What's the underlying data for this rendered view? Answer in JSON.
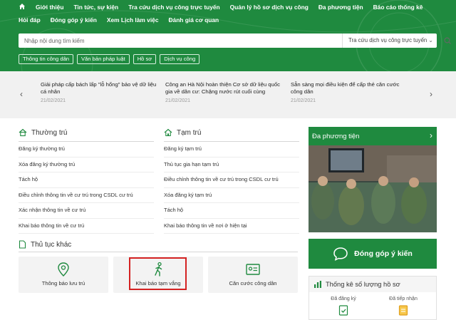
{
  "header": {
    "nav": [
      {
        "id": "home",
        "label": ""
      },
      {
        "id": "gioi-thieu",
        "label": "Giới thiệu"
      },
      {
        "id": "tin-tuc",
        "label": "Tin tức, sự kiện"
      },
      {
        "id": "tra-cuu",
        "label": "Tra cứu dịch vụ công trực tuyến"
      },
      {
        "id": "quan-ly",
        "label": "Quản lý hồ sơ dịch vụ công"
      },
      {
        "id": "da-phuong-tien",
        "label": "Đa phương tiện"
      },
      {
        "id": "bao-cao",
        "label": "Báo cáo thống kê"
      },
      {
        "id": "hoi-dap",
        "label": "Hỏi đáp"
      },
      {
        "id": "dong-gop",
        "label": "Đóng góp ý kiến"
      },
      {
        "id": "lich",
        "label": "Xem Lịch làm việc"
      },
      {
        "id": "danh-gia",
        "label": "Đánh giá cơ quan"
      }
    ],
    "search_placeholder": "Nhập nội dung tìm kiếm",
    "search_scope": "Tra cứu dịch vụ công trực tuyến",
    "tags": [
      "Thông tin công dân",
      "Văn bản pháp luật",
      "Hồ sơ",
      "Dịch vụ công"
    ]
  },
  "news": [
    {
      "title": "Giải pháp cấp bách lấp \"lỗ hổng\" bảo vệ dữ liệu cá nhân",
      "date": "21/02/2021"
    },
    {
      "title": "Công an Hà Nội hoàn thiện Cơ sở dữ liệu quốc gia về dân cư: Chặng nước rút cuối cùng",
      "date": "21/02/2021"
    },
    {
      "title": "Sẵn sàng mọi điều kiện để cấp thẻ căn cước công dân",
      "date": "21/02/2021"
    }
  ],
  "thuong_tru": {
    "title": "Thường trú",
    "items": [
      "Đăng ký thường trú",
      "Xóa đăng ký thường trú",
      "Tách hộ",
      "Điều chỉnh thông tin về cư trú trong CSDL cư trú",
      "Xác nhận thông tin về cư trú",
      "Khai báo thông tin về cư trú"
    ]
  },
  "tam_tru": {
    "title": "Tạm trú",
    "items": [
      "Đăng ký tạm trú",
      "Thủ tục gia hạn tạm trú",
      "Điều chỉnh thông tin về cư trú trong CSDL cư trú",
      "Xóa đăng ký tạm trú",
      "Tách hộ",
      "Khai báo thông tin về nơi ở hiện tại"
    ]
  },
  "other": {
    "title": "Thủ tục khác",
    "cards": [
      "Thông báo lưu trú",
      "Khai báo tạm vắng",
      "Căn cước công dân"
    ]
  },
  "media": {
    "title": "Đa phương tiện"
  },
  "feedback": {
    "label": "Đóng góp ý kiến"
  },
  "stats": {
    "title": "Thống kê số lượng hồ sơ",
    "items": [
      "Đã đăng ký",
      "Đã tiếp nhận"
    ]
  },
  "colors": {
    "brand_green": "#1f8a3f",
    "highlight_red": "#d42222"
  }
}
